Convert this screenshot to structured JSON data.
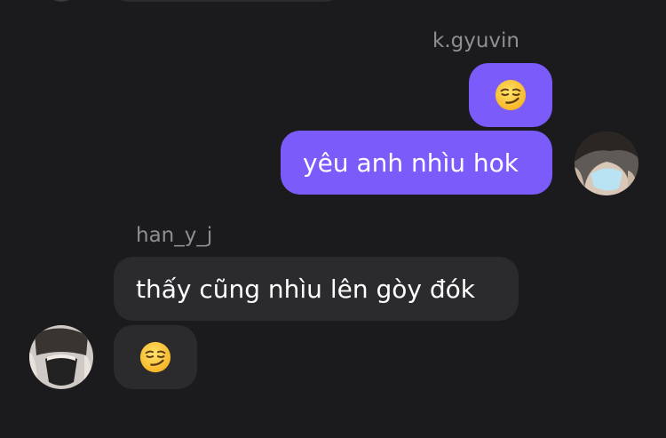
{
  "conversation": {
    "messages": [
      {
        "sender": "k.gyuvin",
        "direction": "outgoing",
        "type": "emoji",
        "emoji": "smirking-face-emoji"
      },
      {
        "sender": "k.gyuvin",
        "direction": "outgoing",
        "type": "text",
        "text": "yêu anh nhìu hok"
      },
      {
        "sender": "han_y_j",
        "direction": "incoming",
        "type": "text",
        "text": "thấy cũng nhìu lên gòy đók"
      },
      {
        "sender": "han_y_j",
        "direction": "incoming",
        "type": "emoji",
        "emoji": "smirking-face-emoji"
      }
    ],
    "senders": {
      "outgoing_name": "k.gyuvin",
      "incoming_name": "han_y_j"
    }
  },
  "colors": {
    "background": "#1b1b1d",
    "outgoing_bubble": "#7b5cfa",
    "incoming_bubble": "#2b2b2e",
    "username_text": "#8e8e93"
  },
  "icons": {
    "outgoing_avatar": "avatar-photo",
    "incoming_avatar": "avatar-photo",
    "emoji": "smirking-face-emoji"
  }
}
